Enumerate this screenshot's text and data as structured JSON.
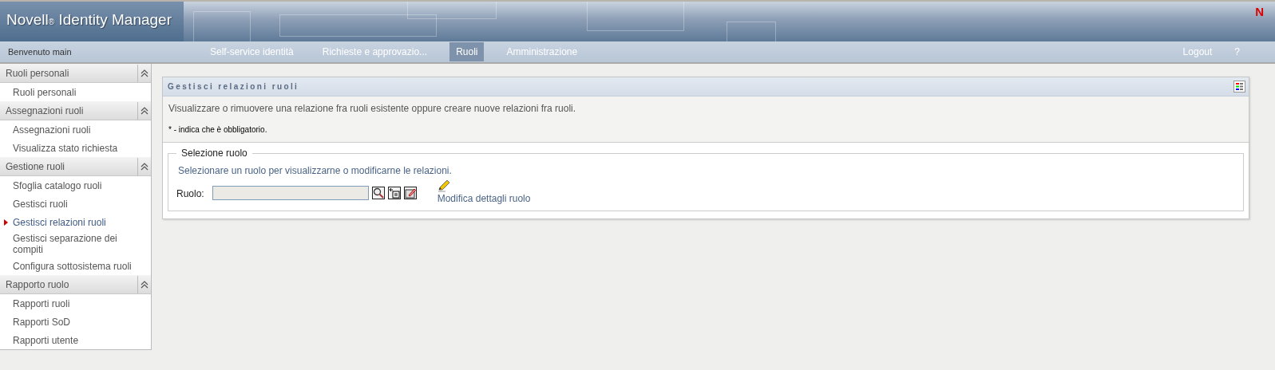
{
  "header": {
    "product": "Novell",
    "registered": "®",
    "title": "Identity Manager",
    "logo": "N"
  },
  "nav": {
    "welcome": "Benvenuto main",
    "tabs": [
      {
        "label": "Self-service identità",
        "selected": false
      },
      {
        "label": "Richieste e approvazio...",
        "selected": false
      },
      {
        "label": "Ruoli",
        "selected": true
      },
      {
        "label": "Amministrazione",
        "selected": false
      }
    ],
    "links": [
      "Logout",
      "?"
    ]
  },
  "sidebar": [
    {
      "title": "Ruoli personali",
      "expanded": true,
      "items": [
        {
          "label": "Ruoli personali",
          "selected": false
        }
      ]
    },
    {
      "title": "Assegnazioni ruoli",
      "expanded": true,
      "items": [
        {
          "label": "Assegnazioni ruoli",
          "selected": false
        },
        {
          "label": "Visualizza stato richiesta",
          "selected": false
        }
      ]
    },
    {
      "title": "Gestione ruoli",
      "expanded": true,
      "items": [
        {
          "label": "Sfoglia catalogo ruoli",
          "selected": false
        },
        {
          "label": "Gestisci ruoli",
          "selected": false
        },
        {
          "label": "Gestisci relazioni ruoli",
          "selected": true
        },
        {
          "label": "Gestisci separazione dei compiti",
          "selected": false
        },
        {
          "label": "Configura sottosistema ruoli",
          "selected": false
        }
      ]
    },
    {
      "title": "Rapporto ruolo",
      "expanded": true,
      "items": [
        {
          "label": "Rapporti ruoli",
          "selected": false
        },
        {
          "label": "Rapporti SoD",
          "selected": false
        },
        {
          "label": "Rapporti utente",
          "selected": false
        }
      ]
    }
  ],
  "panel": {
    "title": "Gestisci relazioni ruoli",
    "description": "Visualizzare o rimuovere una relazione fra ruoli esistente oppure creare nuove relazioni fra ruoli.",
    "required_note": "* - indica che è obbligatorio.",
    "fieldset": {
      "legend": "Selezione ruolo",
      "instruction": "Selezionare un ruolo per visualizzarne o modificarne le relazioni.",
      "field_label": "Ruolo:",
      "edit_link": "Modifica dettagli ruolo"
    }
  }
}
